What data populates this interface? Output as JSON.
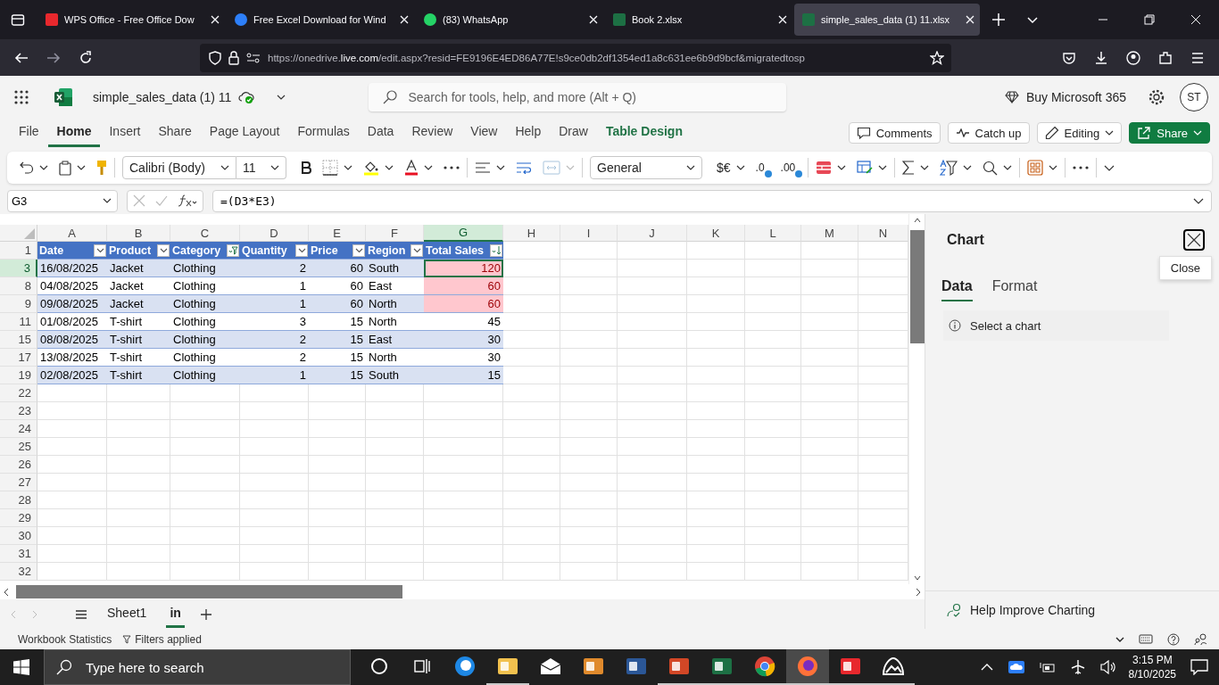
{
  "browser": {
    "tabs": [
      {
        "title": "WPS Office - Free Office Dow",
        "selected": false
      },
      {
        "title": "Free Excel Download for Wind",
        "selected": false
      },
      {
        "title": "(83) WhatsApp",
        "selected": false
      },
      {
        "title": "Book 2.xlsx",
        "selected": false
      },
      {
        "title": "simple_sales_data (1) 11.xlsx",
        "selected": true
      }
    ],
    "url": {
      "prefix": "https://onedrive.",
      "domain": "live.com",
      "rest": "/edit.aspx?resid=FE9196E4ED86A77E!s9ce0db2df1354ed1a8c631ee6b9d9bcf&migratedtosp"
    }
  },
  "app": {
    "file_name": "simple_sales_data (1) 11",
    "search": {
      "placeholder": "Search for tools, help, and more (Alt + Q)"
    },
    "buy": "Buy Microsoft 365",
    "avatar": "ST"
  },
  "menu": {
    "tabs": [
      {
        "label": "File",
        "selected": false,
        "contextual": false
      },
      {
        "label": "Home",
        "selected": true,
        "contextual": false
      },
      {
        "label": "Insert",
        "selected": false,
        "contextual": false
      },
      {
        "label": "Share",
        "selected": false,
        "contextual": false
      },
      {
        "label": "Page Layout",
        "selected": false,
        "contextual": false
      },
      {
        "label": "Formulas",
        "selected": false,
        "contextual": false
      },
      {
        "label": "Data",
        "selected": false,
        "contextual": false
      },
      {
        "label": "Review",
        "selected": false,
        "contextual": false
      },
      {
        "label": "View",
        "selected": false,
        "contextual": false
      },
      {
        "label": "Help",
        "selected": false,
        "contextual": false
      },
      {
        "label": "Draw",
        "selected": false,
        "contextual": false
      },
      {
        "label": "Table Design",
        "selected": false,
        "contextual": true
      }
    ],
    "actions": [
      {
        "label": "Comments",
        "kind": "comments"
      },
      {
        "label": "Catch up",
        "kind": "catchup"
      },
      {
        "label": "Editing",
        "kind": "editing"
      },
      {
        "label": "Share",
        "kind": "share"
      }
    ]
  },
  "ribbon": {
    "font": "Calibri (Body)",
    "size": "11",
    "number_format": "General",
    "currency": "$€",
    "decrease_decimal": ".0",
    "increase_decimal": ".00"
  },
  "formula_bar": {
    "name_box": "G3",
    "formula": "=(D3*E3)"
  },
  "grid": {
    "corner_row": "1",
    "columns": [
      {
        "letter": "A",
        "selected": false
      },
      {
        "letter": "B",
        "selected": false
      },
      {
        "letter": "C",
        "selected": false
      },
      {
        "letter": "D",
        "selected": false
      },
      {
        "letter": "E",
        "selected": false
      },
      {
        "letter": "F",
        "selected": false
      },
      {
        "letter": "G",
        "selected": true
      },
      {
        "letter": "H",
        "selected": false
      },
      {
        "letter": "I",
        "selected": false
      },
      {
        "letter": "J",
        "selected": false
      },
      {
        "letter": "K",
        "selected": false
      },
      {
        "letter": "L",
        "selected": false
      },
      {
        "letter": "M",
        "selected": false
      },
      {
        "letter": "N",
        "selected": false
      }
    ],
    "headers": [
      {
        "title": "Date",
        "kind": "text",
        "filtered": false,
        "sorted": false
      },
      {
        "title": "Product",
        "kind": "text",
        "filtered": false,
        "sorted": false
      },
      {
        "title": "Category",
        "kind": "text",
        "filtered": true,
        "sorted": false
      },
      {
        "title": "Quantity",
        "kind": "number",
        "filtered": false,
        "sorted": false
      },
      {
        "title": "Price",
        "kind": "number",
        "filtered": false,
        "sorted": false
      },
      {
        "title": "Region",
        "kind": "text",
        "filtered": false,
        "sorted": false
      },
      {
        "title": "Total Sales",
        "kind": "number",
        "filtered": false,
        "sorted": true
      }
    ],
    "rows": [
      {
        "number": "3",
        "selected": true,
        "flagged": true,
        "cells": [
          "16/08/2025",
          "Jacket",
          "Clothing",
          "2",
          "60",
          "South",
          "120"
        ]
      },
      {
        "number": "8",
        "selected": false,
        "flagged": true,
        "cells": [
          "04/08/2025",
          "Jacket",
          "Clothing",
          "1",
          "60",
          "East",
          "60"
        ]
      },
      {
        "number": "9",
        "selected": false,
        "flagged": true,
        "cells": [
          "09/08/2025",
          "Jacket",
          "Clothing",
          "1",
          "60",
          "North",
          "60"
        ]
      },
      {
        "number": "11",
        "selected": false,
        "flagged": false,
        "cells": [
          "01/08/2025",
          "T-shirt",
          "Clothing",
          "3",
          "15",
          "North",
          "45"
        ]
      },
      {
        "number": "15",
        "selected": false,
        "flagged": false,
        "cells": [
          "08/08/2025",
          "T-shirt",
          "Clothing",
          "2",
          "15",
          "East",
          "30"
        ]
      },
      {
        "number": "17",
        "selected": false,
        "flagged": false,
        "cells": [
          "13/08/2025",
          "T-shirt",
          "Clothing",
          "2",
          "15",
          "North",
          "30"
        ]
      },
      {
        "number": "19",
        "selected": false,
        "flagged": false,
        "cells": [
          "02/08/2025",
          "T-shirt",
          "Clothing",
          "1",
          "15",
          "South",
          "15"
        ]
      }
    ],
    "empty_rows": [
      "22",
      "23",
      "24",
      "25",
      "26",
      "27",
      "28",
      "29",
      "30",
      "31",
      "32"
    ]
  },
  "sheets": [
    {
      "name": "Sheet1",
      "selected": false
    },
    {
      "name": "in",
      "selected": true
    }
  ],
  "status_bar": {
    "statistics": "Workbook Statistics",
    "filters": "Filters applied"
  },
  "panel": {
    "title": "Chart",
    "tooltip": "Close",
    "tabs": [
      {
        "label": "Data",
        "selected": true
      },
      {
        "label": "Format",
        "selected": false
      }
    ],
    "info": "Select a chart",
    "footer": "Help Improve Charting"
  },
  "taskbar": {
    "search": {
      "placeholder": "Type here to search"
    },
    "time": "3:15 PM",
    "date": "8/10/2025",
    "apps": [
      {
        "kind": "cortana",
        "running": false,
        "selected": false
      },
      {
        "kind": "taskview",
        "running": false,
        "selected": false
      },
      {
        "kind": "edge",
        "running": false,
        "selected": false
      },
      {
        "kind": "folder",
        "running": true,
        "selected": false
      },
      {
        "kind": "mail",
        "running": false,
        "selected": false
      },
      {
        "kind": "camera",
        "running": false,
        "selected": false
      },
      {
        "kind": "word",
        "running": false,
        "selected": false
      },
      {
        "kind": "powerpoint",
        "running": true,
        "selected": false
      },
      {
        "kind": "excel",
        "running": true,
        "selected": false
      },
      {
        "kind": "chrome",
        "running": true,
        "selected": false
      },
      {
        "kind": "firefox",
        "running": true,
        "selected": true
      },
      {
        "kind": "wps",
        "running": true,
        "selected": false
      },
      {
        "kind": "photos",
        "running": true,
        "selected": false
      }
    ]
  }
}
